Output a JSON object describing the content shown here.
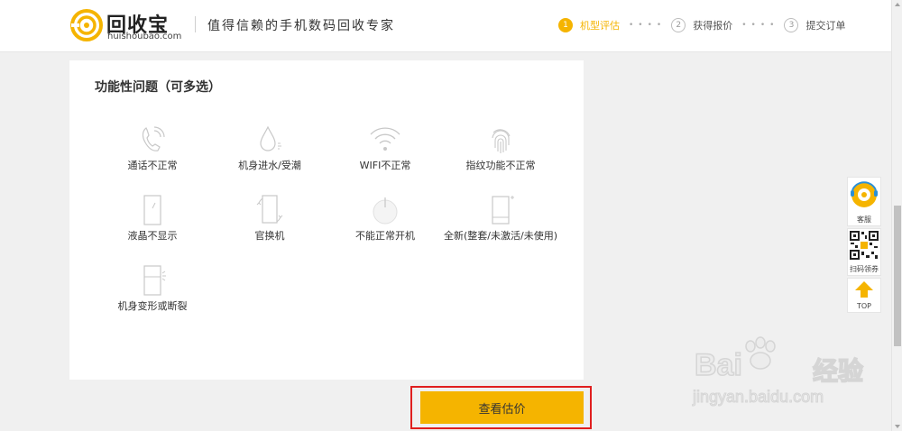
{
  "header": {
    "logo_cn": "回收宝",
    "logo_en": "huishoubao.com",
    "slogan": "值得信赖的手机数码回收专家",
    "steps": [
      {
        "num": "1",
        "label": "机型评估",
        "active": true
      },
      {
        "num": "2",
        "label": "获得报价",
        "active": false
      },
      {
        "num": "3",
        "label": "提交订单",
        "active": false
      }
    ]
  },
  "panel": {
    "title": "功能性问题（可多选）",
    "options": [
      {
        "label": "通话不正常",
        "icon": "phone-call-icon"
      },
      {
        "label": "机身进水/受潮",
        "icon": "water-drop-icon"
      },
      {
        "label": "WIFI不正常",
        "icon": "wifi-icon"
      },
      {
        "label": "指纹功能不正常",
        "icon": "fingerprint-icon"
      },
      {
        "label": "液晶不显示",
        "icon": "blank-screen-icon"
      },
      {
        "label": "官换机",
        "icon": "phone-swap-icon"
      },
      {
        "label": "不能正常开机",
        "icon": "power-icon"
      },
      {
        "label": "全新(整套/未激活/未使用)",
        "icon": "new-phone-icon"
      },
      {
        "label": "机身变形或断裂",
        "icon": "broken-phone-icon"
      }
    ]
  },
  "action": {
    "view_estimate": "查看估价"
  },
  "float_bar": {
    "service_label": "客服",
    "qr_label": "扫码领券",
    "top_label": "TOP"
  },
  "watermark": {
    "brand": "Bai",
    "brand_cn": "经验",
    "url": "jingyan.baidu.com"
  },
  "colors": {
    "accent": "#f5b400",
    "highlight_border": "#e01f1f"
  }
}
